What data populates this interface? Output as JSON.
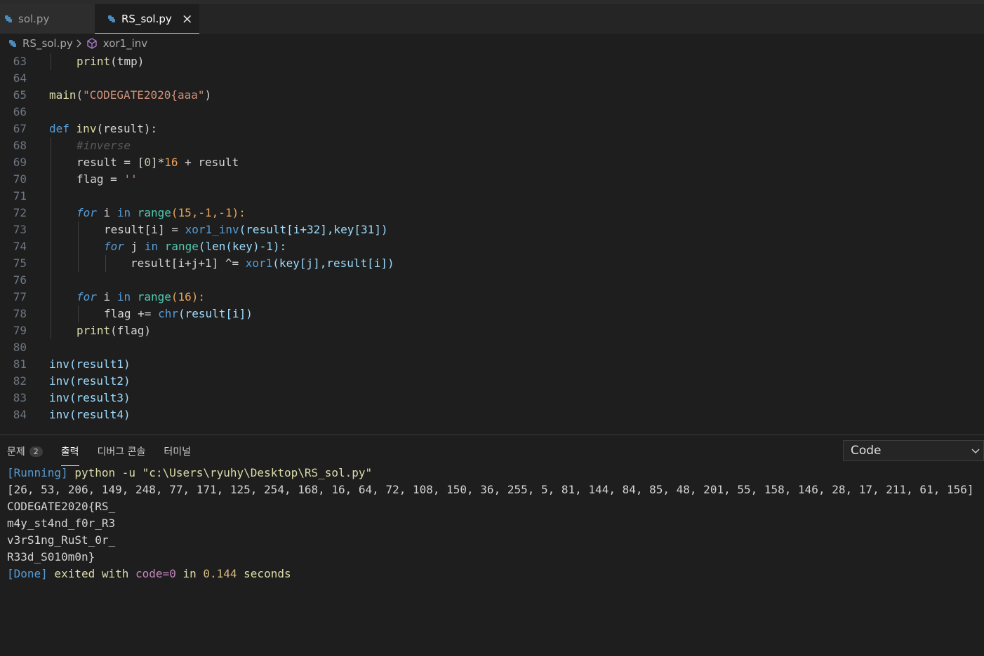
{
  "tabs": [
    {
      "label": "sol.py"
    },
    {
      "label": "RS_sol.py",
      "close": "×"
    }
  ],
  "breadcrumb": {
    "file": "RS_sol.py",
    "symbol": "xor1_inv"
  },
  "code_lines": [
    {
      "n": "63"
    },
    {
      "n": "64"
    },
    {
      "n": "65"
    },
    {
      "n": "66"
    },
    {
      "n": "67"
    },
    {
      "n": "68"
    },
    {
      "n": "69"
    },
    {
      "n": "70"
    },
    {
      "n": "71"
    },
    {
      "n": "72"
    },
    {
      "n": "73"
    },
    {
      "n": "74"
    },
    {
      "n": "75"
    },
    {
      "n": "76"
    },
    {
      "n": "77"
    },
    {
      "n": "78"
    },
    {
      "n": "79"
    },
    {
      "n": "80"
    },
    {
      "n": "81"
    },
    {
      "n": "82"
    },
    {
      "n": "83"
    },
    {
      "n": "84"
    }
  ],
  "code": {
    "l63_print": "print",
    "l63_rest": "(tmp)",
    "l65_main": "main",
    "l65_str": "\"CODEGATE2020{aaa\"",
    "l67_def": "def",
    "l67_fn": "inv",
    "l67_rest": "(result):",
    "l68_cm": "#inverse",
    "l69_a": "result = [",
    "l69_0": "0",
    "l69_b": "]*",
    "l69_16": "16",
    "l69_c": " + result",
    "l70_a": "flag = ",
    "l70_str": "''",
    "l72_for": "for",
    "l72_a": " i ",
    "l72_in": "in",
    "l72_range": " range",
    "l72_args": "(15,-1,-1):",
    "l73_a": "result[i] = ",
    "l73_fn": "xor1_inv",
    "l73_args": "(result[i+32],key[31])",
    "l74_for": "for",
    "l74_a": " j ",
    "l74_in": "in",
    "l74_range": " range",
    "l74_args": "(len(key)-1):",
    "l75_a": "result[i+j+1] ^= ",
    "l75_fn": "xor1",
    "l75_args": "(key[j],result[i])",
    "l77_for": "for",
    "l77_a": " i ",
    "l77_in": "in",
    "l77_range": " range",
    "l77_args": "(16):",
    "l78_a": "flag += ",
    "l78_fn": "chr",
    "l78_args": "(result[i])",
    "l79_print": "print",
    "l79_rest": "(flag)",
    "l81": "inv(result1)",
    "l82": "inv(result2)",
    "l83": "inv(result3)",
    "l84": "inv(result4)"
  },
  "panel": {
    "tabs": [
      {
        "label": "문제",
        "badge": "2"
      },
      {
        "label": "출력"
      },
      {
        "label": "디버그 콘솔"
      },
      {
        "label": "터미널"
      }
    ],
    "select_value": "Code",
    "output": {
      "running_tag": "[Running]",
      "running_cmd": " python -u ",
      "running_path": "\"c:\\Users\\ryuhy\\Desktop\\RS_sol.py\"",
      "list": "[26, 53, 206, 149, 248, 77, 171, 125, 254, 168, 16, 64, 72, 108, 150, 36, 255, 5, 81, 144, 84, 85, 48, 201, 55, 158, 146, 28, 17, 211, 61, 156]",
      "flag1": "CODEGATE2020{RS_",
      "flag2": "m4y_st4nd_f0r_R3",
      "flag3": "v3rS1ng_RuSt_0r_",
      "flag4": "R33d_S010m0n}",
      "done_tag": "[Done]",
      "done_a": " exited with ",
      "done_code": "code=0",
      "done_in": " in ",
      "done_time": "0.144",
      "done_sec": " seconds"
    }
  },
  "colors": {
    "accent_tab": "#d7ba7d",
    "keyword": "#569cd6",
    "function": "#dcdcaa",
    "string": "#ce9178",
    "number": "#b5cea8"
  }
}
